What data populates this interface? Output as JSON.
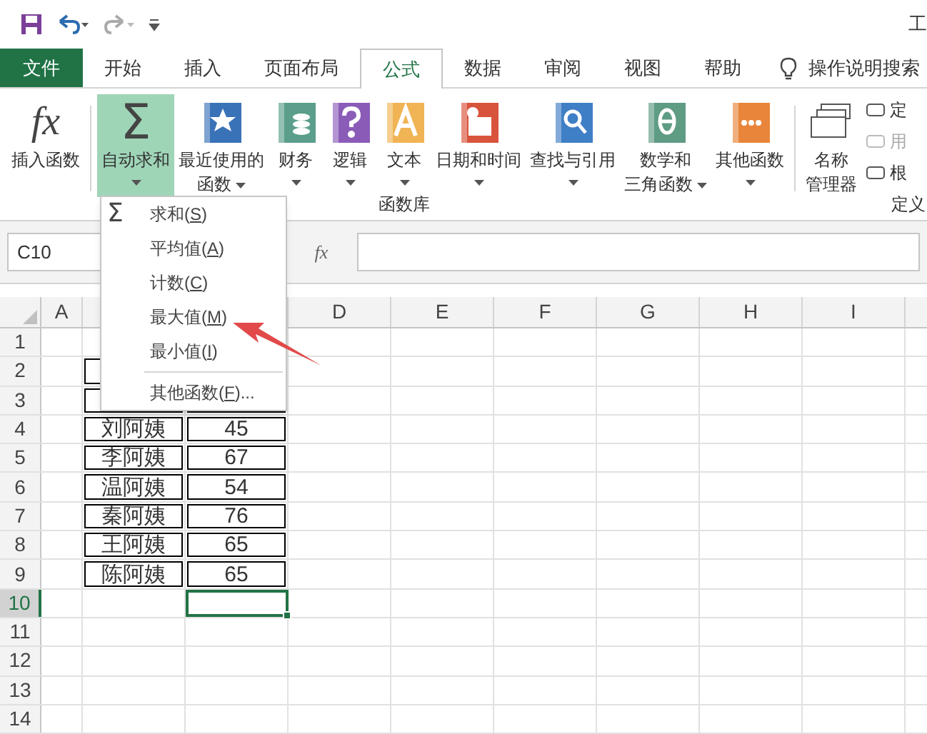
{
  "window": {
    "title": "工"
  },
  "tabs": [
    {
      "label": "文件",
      "kind": "file",
      "selected": false
    },
    {
      "label": "开始",
      "kind": "tab",
      "selected": false
    },
    {
      "label": "插入",
      "kind": "tab",
      "selected": false
    },
    {
      "label": "页面布局",
      "kind": "tab",
      "selected": false
    },
    {
      "label": "公式",
      "kind": "tab",
      "selected": true
    },
    {
      "label": "数据",
      "kind": "tab",
      "selected": false
    },
    {
      "label": "审阅",
      "kind": "tab",
      "selected": false
    },
    {
      "label": "视图",
      "kind": "tab",
      "selected": false
    },
    {
      "label": "帮助",
      "kind": "tab",
      "selected": false
    }
  ],
  "search": {
    "label": "操作说明搜索"
  },
  "ribbon": {
    "buttons": [
      {
        "kind": "fx",
        "glyph": "fx",
        "lines": [
          "插入函数"
        ],
        "dropdown": false,
        "pressed": false
      },
      {
        "kind": "sigma",
        "glyph": "Σ",
        "lines": [
          "自动求和"
        ],
        "dropdown": true,
        "pressed": true
      },
      {
        "kind": "book",
        "color": "#3a72b8",
        "lines": [
          "最近使用的",
          "函数"
        ],
        "dropdown": true,
        "pressed": false
      },
      {
        "kind": "book",
        "color": "#5b9e8c",
        "lines": [
          "财务"
        ],
        "dropdown": true,
        "pressed": false
      },
      {
        "kind": "book",
        "color": "#8a5cb8",
        "lines": [
          "逻辑"
        ],
        "dropdown": true,
        "pressed": false
      },
      {
        "kind": "book",
        "color": "#f0b455",
        "lines": [
          "文本"
        ],
        "dropdown": true,
        "pressed": false
      },
      {
        "kind": "book",
        "color": "#d9543c",
        "lines": [
          "日期和时间"
        ],
        "dropdown": true,
        "pressed": false
      },
      {
        "kind": "book",
        "color": "#3f7fc6",
        "lines": [
          "查找与引用"
        ],
        "dropdown": true,
        "pressed": false
      },
      {
        "kind": "book",
        "color": "#5e9c84",
        "lines": [
          "数学和",
          "三角函数"
        ],
        "dropdown": true,
        "pressed": false
      },
      {
        "kind": "book",
        "color": "#e8853a",
        "lines": [
          "其他函数"
        ],
        "dropdown": true,
        "pressed": false
      },
      {
        "kind": "names",
        "lines": [
          "名称",
          "管理器"
        ],
        "dropdown": false,
        "pressed": false
      }
    ],
    "small_items": [
      {
        "label": "定",
        "disabled": false
      },
      {
        "label": "用",
        "disabled": true
      },
      {
        "label": "根",
        "disabled": false
      }
    ],
    "groups": [
      {
        "label": "函数库"
      },
      {
        "label": "定义"
      }
    ]
  },
  "formula_bar": {
    "name_box": "C10",
    "fx": "fx"
  },
  "menu": {
    "items": [
      {
        "glyph": "Σ",
        "label": "求和(",
        "key": "S",
        "suffix": ")",
        "separator": false
      },
      {
        "label": "平均值(",
        "key": "A",
        "suffix": ")",
        "separator": false
      },
      {
        "label": "计数(",
        "key": "C",
        "suffix": ")",
        "separator": false
      },
      {
        "label": "最大值(",
        "key": "M",
        "suffix": ")",
        "separator": false
      },
      {
        "label": "最小值(",
        "key": "I",
        "suffix": ")",
        "separator": false
      },
      {
        "separator": true,
        "label": "其他函数(",
        "key": "F",
        "suffix": ")..."
      }
    ]
  },
  "sheet": {
    "columns": [
      "A",
      null,
      null,
      "D",
      "E",
      "F",
      "G",
      "H",
      "I"
    ],
    "rows": [
      {
        "label": "1",
        "selected": false
      },
      {
        "label": "2",
        "selected": false
      },
      {
        "label": "3",
        "selected": false
      },
      {
        "label": "4",
        "selected": false
      },
      {
        "label": "5",
        "selected": false
      },
      {
        "label": "6",
        "selected": false
      },
      {
        "label": "7",
        "selected": false
      },
      {
        "label": "8",
        "selected": false
      },
      {
        "label": "9",
        "selected": false
      },
      {
        "label": "10",
        "selected": true
      },
      {
        "label": "11",
        "selected": false
      },
      {
        "label": "12",
        "selected": false
      },
      {
        "label": "13",
        "selected": false
      },
      {
        "label": "14",
        "selected": false
      }
    ],
    "table": [
      {
        "name": "刘阿姨",
        "value": "45"
      },
      {
        "name": "李阿姨",
        "value": "67"
      },
      {
        "name": "温阿姨",
        "value": "54"
      },
      {
        "name": "秦阿姨",
        "value": "76"
      },
      {
        "name": "王阿姨",
        "value": "65"
      },
      {
        "name": "陈阿姨",
        "value": "65"
      }
    ]
  }
}
